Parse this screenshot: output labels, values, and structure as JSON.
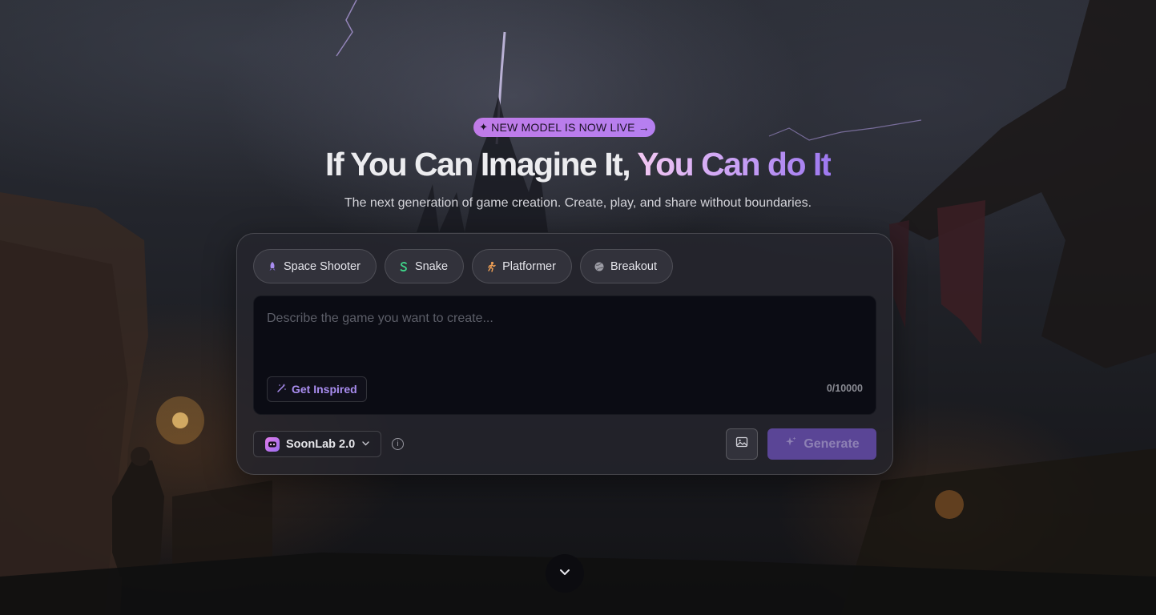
{
  "hero": {
    "badge_label": "NEW MODEL IS NOW LIVE →",
    "headline_part1": "If You Can Imagine It, ",
    "headline_part2": "You Can do It",
    "subline": "The next generation of game creation. Create, play, and share without boundaries."
  },
  "templates": [
    {
      "label": "Space Shooter",
      "icon": "rocket-icon",
      "color": "#a98df0"
    },
    {
      "label": "Snake",
      "icon": "snake-icon",
      "color": "#3fd68a"
    },
    {
      "label": "Platformer",
      "icon": "running-figure-icon",
      "color": "#f0a055"
    },
    {
      "label": "Breakout",
      "icon": "ball-icon",
      "color": "#b0b0b8"
    }
  ],
  "prompt": {
    "placeholder": "Describe the game you want to create...",
    "value": "",
    "inspire_label": "Get Inspired",
    "counter": "0/10000"
  },
  "controls": {
    "model_label": "SoonLab 2.0",
    "generate_label": "Generate"
  },
  "colors": {
    "accent": "#a98df0",
    "badge": "#c07be8",
    "generate_bg": "#5a4596"
  }
}
